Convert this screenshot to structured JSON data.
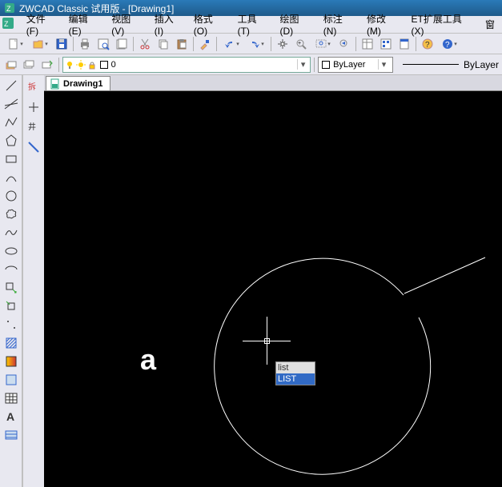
{
  "title": "ZWCAD Classic 试用版 - [Drawing1]",
  "menu": {
    "file": "文件(F)",
    "edit": "编辑(E)",
    "view": "视图(V)",
    "insert": "插入(I)",
    "format": "格式(O)",
    "tools": "工具(T)",
    "draw": "绘图(D)",
    "dim": "标注(N)",
    "modify": "修改(M)",
    "et": "ET扩展工具(X)",
    "window": "窗"
  },
  "tab": {
    "label": "Drawing1"
  },
  "layer": {
    "current": "0"
  },
  "linetype": {
    "bylayer": "ByLayer",
    "bylayer2": "ByLayer"
  },
  "cmd": {
    "input": "list",
    "suggest": "LIST"
  },
  "glyph": "a",
  "icons": {
    "new": "new",
    "open": "open",
    "save": "save",
    "print": "print",
    "cut": "cut",
    "copy": "copy",
    "paste": "paste",
    "undo": "undo",
    "redo": "redo",
    "pan": "pan",
    "bulb": "bulb",
    "sun": "sun",
    "lock": "lock"
  }
}
